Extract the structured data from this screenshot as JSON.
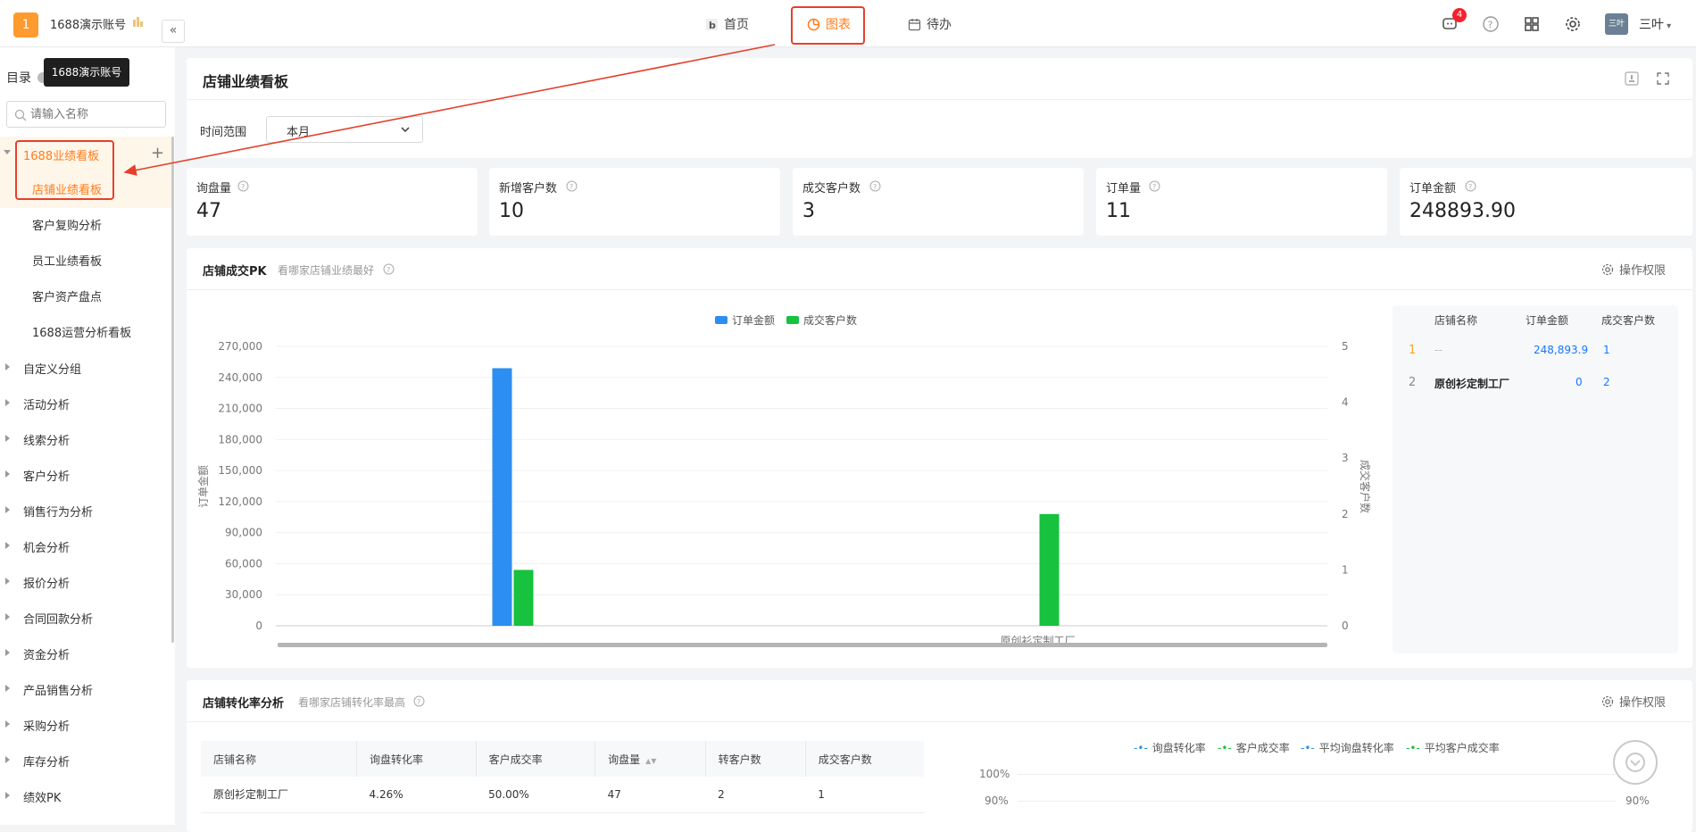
{
  "topbar": {
    "logo_number": "1",
    "account_name": "1688演示账号",
    "nav": [
      {
        "label": "首页",
        "icon": "home-b-icon"
      },
      {
        "label": "图表",
        "icon": "pie-chart-icon",
        "active": true
      },
      {
        "label": "待办",
        "icon": "calendar-icon"
      }
    ],
    "notification_count": "4",
    "avatar_text": "三叶",
    "user_name": "三叶"
  },
  "sidebar": {
    "title": "目录",
    "tooltip": "1688演示账号",
    "search_placeholder": "请输入名称",
    "group": {
      "label": "1688业绩看板",
      "items": [
        "店铺业绩看板",
        "客户复购分析",
        "员工业绩看板",
        "客户资产盘点",
        "1688运营分析看板"
      ]
    },
    "categories": [
      "自定义分组",
      "活动分析",
      "线索分析",
      "客户分析",
      "销售行为分析",
      "机会分析",
      "报价分析",
      "合同回款分析",
      "资金分析",
      "产品销售分析",
      "采购分析",
      "库存分析",
      "绩效PK"
    ]
  },
  "main": {
    "title": "店铺业绩看板",
    "filter_label": "时间范围",
    "filter_value": "本月",
    "kpis": [
      {
        "label": "询盘量",
        "value": "47"
      },
      {
        "label": "新增客户数",
        "value": "10"
      },
      {
        "label": "成交客户数",
        "value": "3"
      },
      {
        "label": "订单量",
        "value": "11"
      },
      {
        "label": "订单金额",
        "value": "248893.90"
      }
    ],
    "pk_section": {
      "title": "店铺成交PK",
      "subtitle": "看哪家店铺业绩最好",
      "permission": "操作权限"
    },
    "rank_table": {
      "headers": [
        "店铺名称",
        "订单金额",
        "成交客户数"
      ],
      "rows": [
        {
          "rank": "1",
          "name": "--",
          "amount": "248,893.9",
          "customers": "1"
        },
        {
          "rank": "2",
          "name": "原创衫定制工厂",
          "amount": "0",
          "customers": "2"
        }
      ]
    },
    "conv_section": {
      "title": "店铺转化率分析",
      "subtitle": "看哪家店铺转化率最高",
      "permission": "操作权限",
      "headers": [
        "店铺名称",
        "询盘转化率",
        "客户成交率",
        "询盘量",
        "转客户数",
        "成交客户数"
      ],
      "rows": [
        [
          "原创衫定制工厂",
          "4.26%",
          "50.00%",
          "47",
          "2",
          "1"
        ]
      ],
      "legend": [
        "询盘转化率",
        "客户成交率",
        "平均询盘转化率",
        "平均客户成交率"
      ],
      "y_ticks": [
        "100%",
        "90%"
      ],
      "y_right_ticks": [
        "90%"
      ]
    }
  },
  "chart_data": {
    "type": "bar",
    "categories": [
      "--",
      "原创衫定制工厂"
    ],
    "x_tick_labels": [
      "",
      "原创衫定制工厂"
    ],
    "series": [
      {
        "name": "订单金额",
        "values": [
          248893.9,
          0
        ],
        "color": "#2b8ef0",
        "axis": "left"
      },
      {
        "name": "成交客户数",
        "values": [
          1,
          2
        ],
        "color": "#16c23e",
        "axis": "right"
      }
    ],
    "ylabel": "订单金额",
    "y2label": "成交客户数",
    "ylim": [
      0,
      270000
    ],
    "y2lim": [
      0,
      5
    ],
    "y_ticks": [
      "0",
      "30,000",
      "60,000",
      "90,000",
      "120,000",
      "150,000",
      "180,000",
      "210,000",
      "240,000",
      "270,000"
    ],
    "y2_ticks": [
      "0",
      "1",
      "2",
      "3",
      "4",
      "5"
    ],
    "legend_position": "top-center",
    "grid": true
  },
  "colors": {
    "accent": "#ff7d1a",
    "annotation": "#e4402d",
    "link": "#1677ff"
  }
}
